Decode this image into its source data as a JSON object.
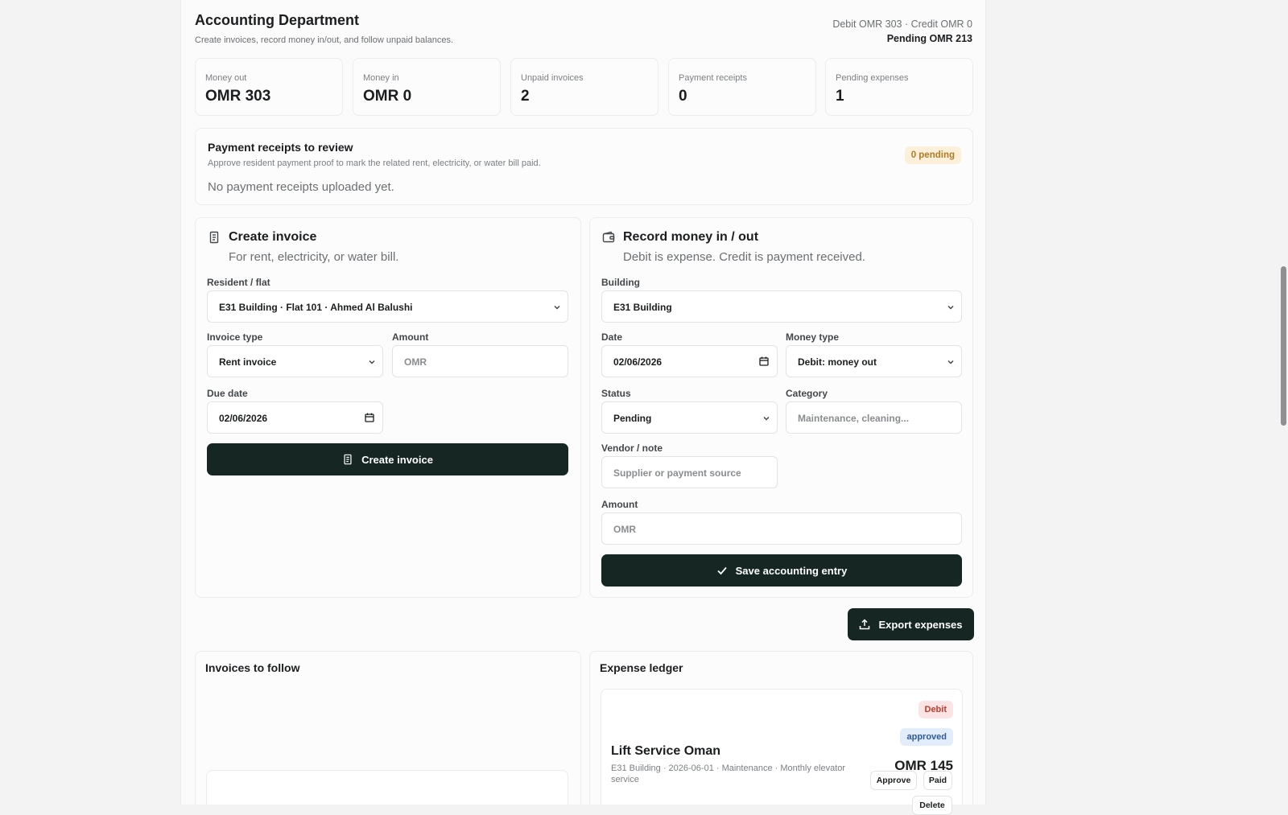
{
  "header": {
    "title": "Accounting Department",
    "subtitle": "Create invoices, record money in/out, and follow unpaid balances.",
    "summary_line": "Debit OMR 303 · Credit OMR 0",
    "pending_line": "Pending OMR 213"
  },
  "stats": [
    {
      "label": "Money out",
      "value": "OMR 303"
    },
    {
      "label": "Money in",
      "value": "OMR 0"
    },
    {
      "label": "Unpaid invoices",
      "value": "2"
    },
    {
      "label": "Payment receipts",
      "value": "0"
    },
    {
      "label": "Pending expenses",
      "value": "1"
    }
  ],
  "receipts": {
    "title": "Payment receipts to review",
    "subtitle": "Approve resident payment proof to mark the related rent, electricity, or water bill paid.",
    "badge": "0 pending",
    "empty": "No payment receipts uploaded yet."
  },
  "invoice_form": {
    "icon": "receipt-icon",
    "title": "Create invoice",
    "subtitle": "For rent, electricity, or water bill.",
    "resident_label": "Resident / flat",
    "resident_value": "E31 Building · Flat 101 · Ahmed Al Balushi",
    "type_label": "Invoice type",
    "type_value": "Rent invoice",
    "amount_label": "Amount",
    "amount_placeholder": "OMR",
    "due_label": "Due date",
    "due_value": "02/06/2026",
    "submit": "Create invoice"
  },
  "money_form": {
    "icon": "wallet-icon",
    "title": "Record money in / out",
    "subtitle": "Debit is expense. Credit is payment received.",
    "building_label": "Building",
    "building_value": "E31 Building",
    "date_label": "Date",
    "date_value": "02/06/2026",
    "type_label": "Money type",
    "type_value": "Debit: money out",
    "status_label": "Status",
    "status_value": "Pending",
    "category_label": "Category",
    "category_placeholder": "Maintenance, cleaning...",
    "vendor_label": "Vendor / note",
    "vendor_placeholder": "Supplier or payment source",
    "amount_label": "Amount",
    "amount_placeholder": "OMR",
    "submit": "Save accounting entry"
  },
  "export_button": "Export expenses",
  "invoices_panel": {
    "title": "Invoices to follow"
  },
  "ledger": {
    "title": "Expense ledger",
    "entries": [
      {
        "kind": "Debit",
        "status": "approved",
        "vendor": "Lift Service Oman",
        "meta": "E31 Building · 2026-06-01 · Maintenance · Monthly elevator service",
        "amount": "OMR 145",
        "actions": [
          "Approve",
          "Paid",
          "Delete"
        ]
      }
    ]
  },
  "colors": {
    "primary_dark": "#162622",
    "debit_badge_bg": "#fde4e4",
    "debit_badge_text": "#c0392b",
    "approved_badge_bg": "#e2ecfb",
    "approved_badge_text": "#2c5aa0",
    "pending_badge_bg": "#fdf0da"
  }
}
